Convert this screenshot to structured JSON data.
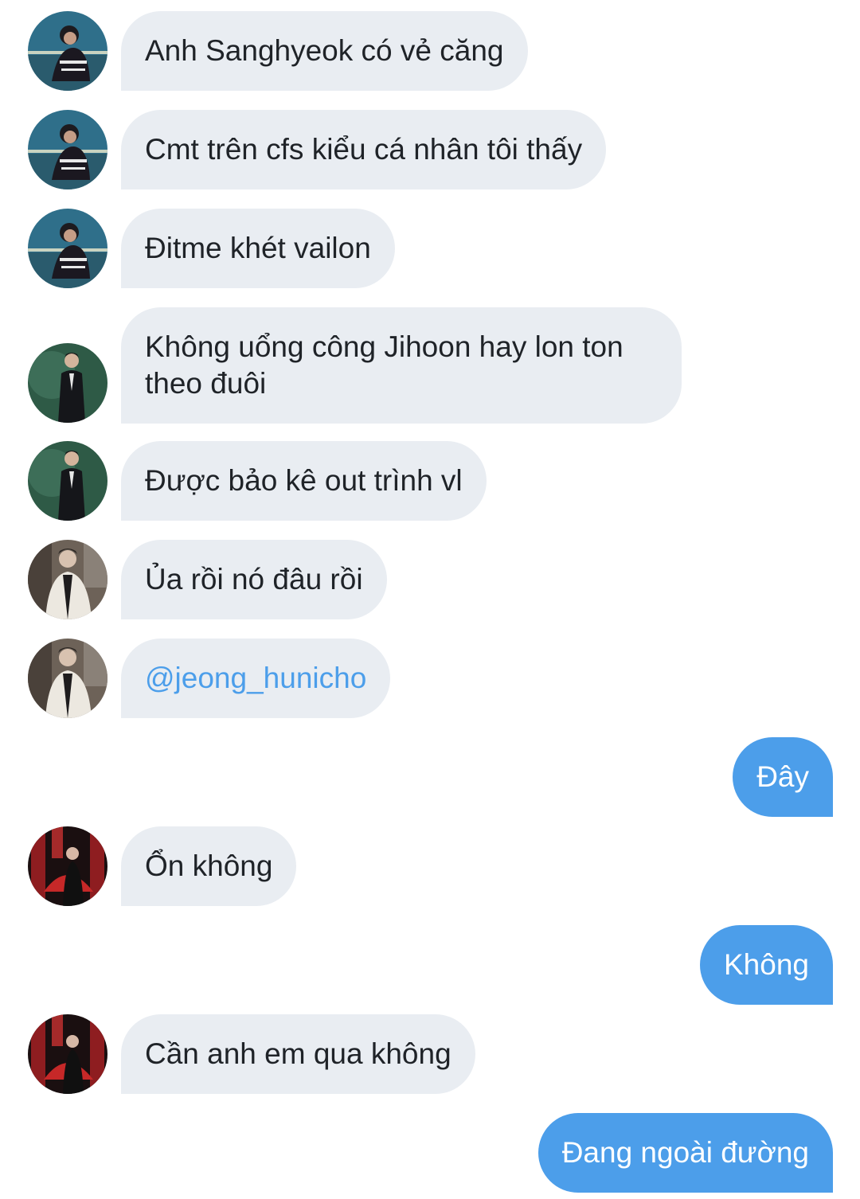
{
  "messages": [
    {
      "side": "in",
      "avatar": "avatar-a",
      "text": "Anh Sanghyeok có vẻ căng"
    },
    {
      "side": "in",
      "avatar": "avatar-a",
      "text": "Cmt trên cfs kiểu cá nhân tôi thấy"
    },
    {
      "side": "in",
      "avatar": "avatar-a",
      "text": "Đitme khét vailon"
    },
    {
      "side": "in",
      "avatar": "avatar-b",
      "text": "Không uổng công Jihoon hay lon ton theo đuôi"
    },
    {
      "side": "in",
      "avatar": "avatar-b",
      "text": "Được bảo kê out trình vl"
    },
    {
      "side": "in",
      "avatar": "avatar-c",
      "text": "Ủa rồi nó đâu rồi"
    },
    {
      "side": "in",
      "avatar": "avatar-c",
      "text": "@jeong_hunicho"
    },
    {
      "side": "out",
      "text": "Đây"
    },
    {
      "side": "in",
      "avatar": "avatar-d",
      "text": "Ổn không"
    },
    {
      "side": "out",
      "text": "Không"
    },
    {
      "side": "in",
      "avatar": "avatar-d",
      "text": "Cần anh em qua không"
    },
    {
      "side": "out",
      "text": "Đang ngoài đường"
    }
  ],
  "colors": {
    "incoming_bubble": "#e9edf2",
    "outgoing_bubble": "#4c9eea",
    "mention": "#4c9eea",
    "text": "#1f2328"
  }
}
